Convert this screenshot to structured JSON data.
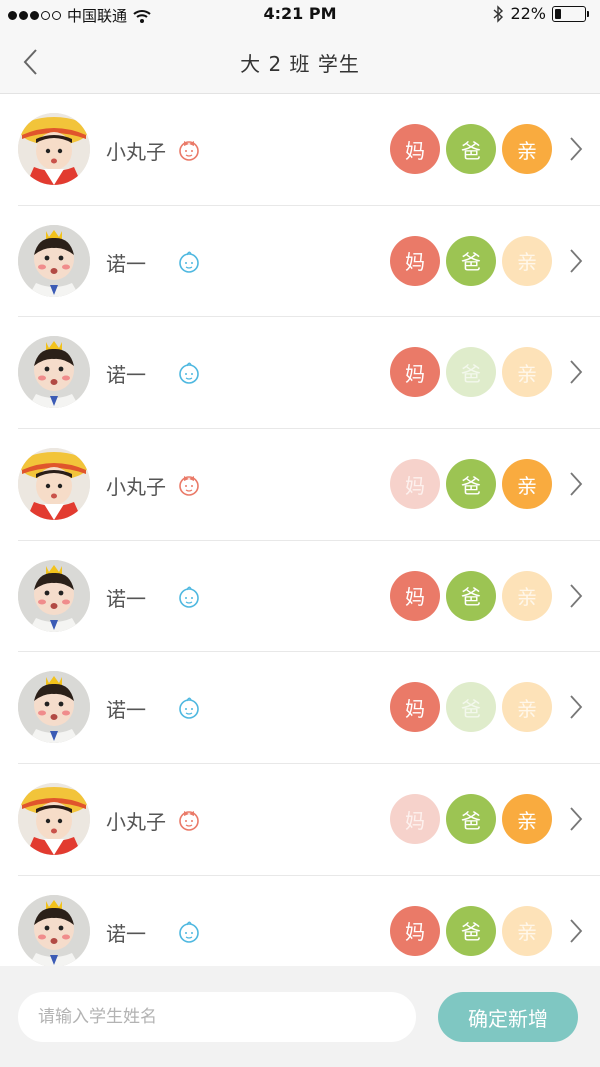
{
  "status_bar": {
    "carrier": "中国联通",
    "time": "4:21 PM",
    "battery_text": "22%",
    "battery_level": 0.22
  },
  "nav": {
    "title": "大 2 班 学生",
    "back_icon": "chevron-left-icon"
  },
  "colors": {
    "mom": "#ea7a68",
    "dad": "#9cc453",
    "relative": "#f9ab3f",
    "confirm": "#7fc7c2",
    "boy_icon": "#4fb8e0",
    "girl_icon": "#ea7a68"
  },
  "parent_labels": {
    "mom": "妈",
    "dad": "爸",
    "relative": "亲"
  },
  "students": [
    {
      "name": "小丸子",
      "gender": "girl",
      "avatar": "girl-hat",
      "mom": true,
      "dad": true,
      "relative": true
    },
    {
      "name": "诺一",
      "gender": "boy",
      "avatar": "boy-crown",
      "mom": true,
      "dad": true,
      "relative": false
    },
    {
      "name": "诺一",
      "gender": "boy",
      "avatar": "boy-crown",
      "mom": true,
      "dad": false,
      "relative": false
    },
    {
      "name": "小丸子",
      "gender": "girl",
      "avatar": "girl-hat",
      "mom": false,
      "dad": true,
      "relative": true
    },
    {
      "name": "诺一",
      "gender": "boy",
      "avatar": "boy-crown",
      "mom": true,
      "dad": true,
      "relative": false
    },
    {
      "name": "诺一",
      "gender": "boy",
      "avatar": "boy-crown",
      "mom": true,
      "dad": false,
      "relative": false
    },
    {
      "name": "小丸子",
      "gender": "girl",
      "avatar": "girl-hat",
      "mom": false,
      "dad": true,
      "relative": true
    },
    {
      "name": "诺一",
      "gender": "boy",
      "avatar": "boy-crown",
      "mom": true,
      "dad": true,
      "relative": false
    }
  ],
  "bottom": {
    "input_placeholder": "请输入学生姓名",
    "input_value": "",
    "confirm_label": "确定新增"
  }
}
